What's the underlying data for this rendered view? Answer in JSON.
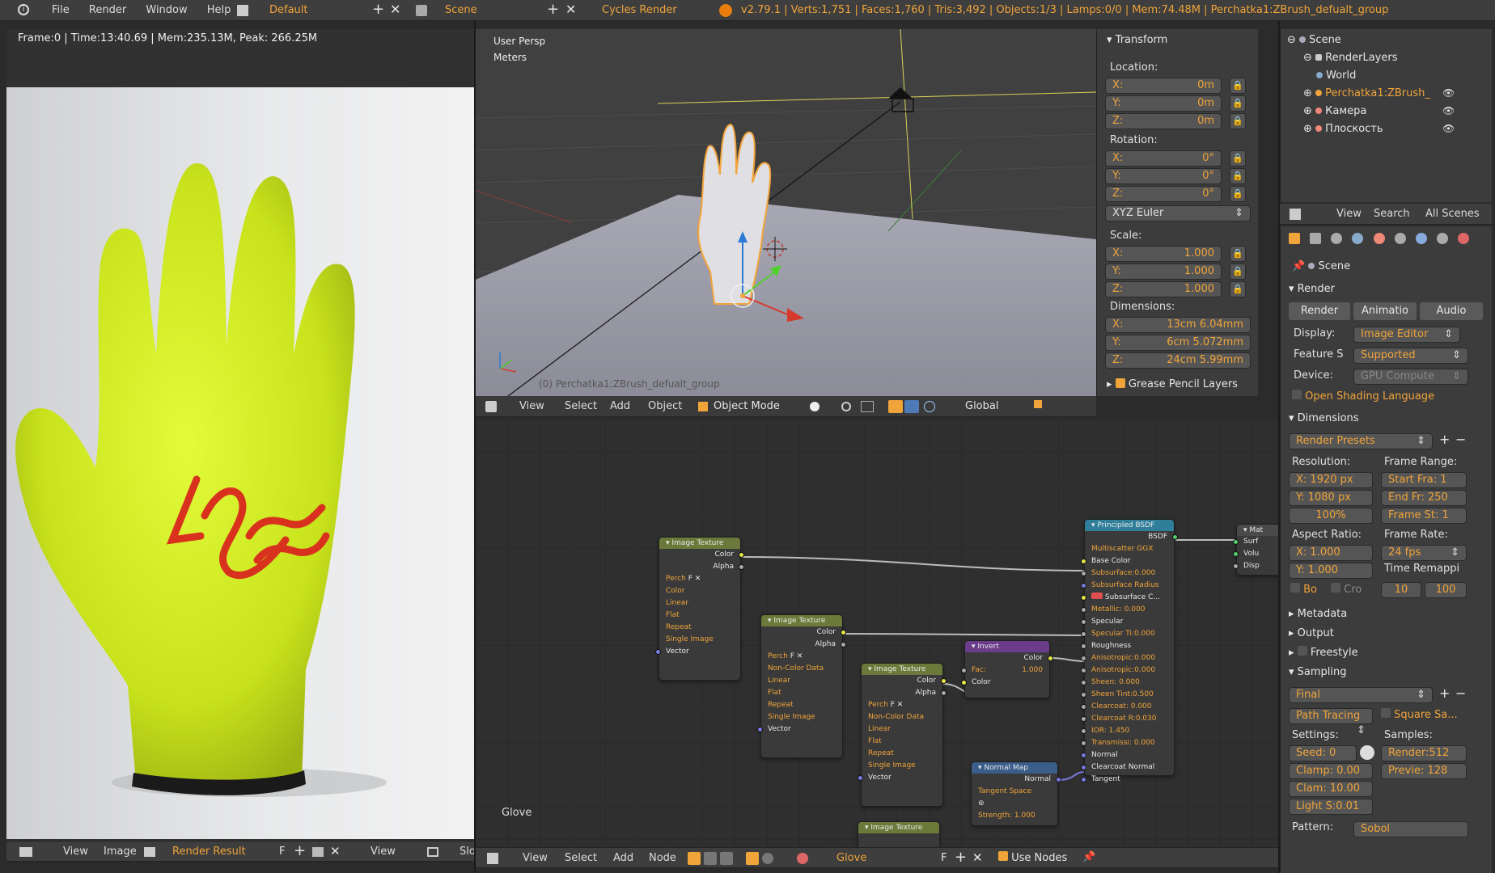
{
  "topbar": {
    "menus": [
      "File",
      "Render",
      "Window",
      "Help"
    ],
    "layout": "Default",
    "scene": "Scene",
    "engine": "Cycles Render",
    "stats": "v2.79.1 | Verts:1,751 | Faces:1,760 | Tris:3,492 | Objects:1/3 | Lamps:0/0 | Mem:74.48M | Perchatka1:ZBrush_defualt_group"
  },
  "image_editor": {
    "header": "Frame:0 | Time:13:40.69 | Mem:235.13M, Peak: 266.25M",
    "footer": {
      "view": "View",
      "image": "Image",
      "name": "Render Result",
      "f": "F",
      "view2": "View",
      "slot": "Slot"
    }
  },
  "viewport": {
    "persp": "User Persp",
    "units": "Meters",
    "object_label": "(0) Perchatka1:ZBrush_defualt_group",
    "header": {
      "view": "View",
      "select": "Select",
      "add": "Add",
      "object": "Object",
      "mode": "Object Mode",
      "orientation": "Global"
    }
  },
  "transform": {
    "title": "Transform",
    "location_label": "Location:",
    "location": [
      {
        "axis": "X:",
        "value": "0m"
      },
      {
        "axis": "Y:",
        "value": "0m"
      },
      {
        "axis": "Z:",
        "value": "0m"
      }
    ],
    "rotation_label": "Rotation:",
    "rotation": [
      {
        "axis": "X:",
        "value": "0°"
      },
      {
        "axis": "Y:",
        "value": "0°"
      },
      {
        "axis": "Z:",
        "value": "0°"
      }
    ],
    "rotation_mode": "XYZ Euler",
    "scale_label": "Scale:",
    "scale": [
      {
        "axis": "X:",
        "value": "1.000"
      },
      {
        "axis": "Y:",
        "value": "1.000"
      },
      {
        "axis": "Z:",
        "value": "1.000"
      }
    ],
    "dimensions_label": "Dimensions:",
    "dimensions": [
      {
        "axis": "X:",
        "value": "13cm 6.04mm"
      },
      {
        "axis": "Y:",
        "value": "6cm 5.072mm"
      },
      {
        "axis": "Z:",
        "value": "24cm 5.99mm"
      }
    ],
    "grease": "Grease Pencil Layers"
  },
  "outliner": {
    "items": [
      {
        "label": "Scene"
      },
      {
        "label": "RenderLayers"
      },
      {
        "label": "World"
      },
      {
        "label": "Perchatka1:ZBrush_"
      },
      {
        "label": "Камера"
      },
      {
        "label": "Плоскость"
      }
    ],
    "header": {
      "view": "View",
      "search": "Search",
      "scenes": "All Scenes"
    }
  },
  "properties": {
    "context": "Scene",
    "render_panel": "Render",
    "render_btn": "Render",
    "anim_btn": "Animatio",
    "audio_btn": "Audio",
    "display_label": "Display:",
    "display_value": "Image Editor",
    "feature_label": "Feature S",
    "feature_value": "Supported",
    "device_label": "Device:",
    "device_value": "GPU Compute",
    "osl": "Open Shading Language",
    "dimensions_panel": "Dimensions",
    "presets": "Render Presets",
    "resolution_label": "Resolution:",
    "res_x": "X:  1920 px",
    "res_y": "Y:  1080 px",
    "res_pct": "100%",
    "frame_range_label": "Frame Range:",
    "start": "Start Fra:  1",
    "end": "End Fr:  250",
    "step": "Frame St:  1",
    "aspect_label": "Aspect Ratio:",
    "asp_x": "X:     1.000",
    "asp_y": "Y:     1.000",
    "fps_label": "Frame Rate:",
    "fps": "24 fps",
    "remap_label": "Time Remappi",
    "remap_old": "10",
    "remap_new": "100",
    "bo": "Bo",
    "cro": "Cro",
    "metadata": "Metadata",
    "output": "Output",
    "freestyle": "Freestyle",
    "sampling": "Sampling",
    "final": "Final",
    "path_tracing": "Path Tracing",
    "square": "Square Sa...",
    "settings_label": "Settings:",
    "samples_label": "Samples:",
    "seed": "Seed:  0",
    "render_samples": "Render:512",
    "clamp1": "Clamp: 0.00",
    "preview": "Previe:  128",
    "clamp2": "Clam: 10.00",
    "light": "Light S:0.01",
    "pattern": "Pattern:",
    "pattern_val": "Sobol"
  },
  "node_editor": {
    "material": "Glove",
    "header": {
      "view": "View",
      "select": "Select",
      "add": "Add",
      "node": "Node",
      "material": "Glove",
      "f": "F",
      "use_nodes": "Use Nodes"
    },
    "img1": {
      "title": "Image Texture",
      "color": "Color",
      "alpha": "Alpha",
      "img": "Perch",
      "f": "F",
      "cs": "Color",
      "interp": "Linear",
      "proj": "Flat",
      "ext": "Repeat",
      "src": "Single Image",
      "vector": "Vector"
    },
    "img2": {
      "title": "Image Texture",
      "color": "Color",
      "alpha": "Alpha",
      "img": "Perch",
      "f": "F",
      "cs": "Non-Color Data",
      "interp": "Linear",
      "proj": "Flat",
      "ext": "Repeat",
      "src": "Single Image",
      "vector": "Vector"
    },
    "img3": {
      "title": "Image Texture",
      "color": "Color",
      "alpha": "Alpha",
      "img": "Perch",
      "f": "F",
      "cs": "Non-Color Data",
      "interp": "Linear",
      "proj": "Flat",
      "ext": "Repeat",
      "src": "Single Image",
      "vector": "Vector"
    },
    "invert": {
      "title": "Invert",
      "color_out": "Color",
      "fac": "Fac:",
      "fac_val": "1.000",
      "color_in": "Color"
    },
    "normalmap": {
      "title": "Normal Map",
      "normal": "Normal",
      "space": "Tangent Space",
      "strength": "Strength: 1.000"
    },
    "img4": {
      "title": "Image Texture"
    },
    "bsdf": {
      "title": "Principled BSDF",
      "out": "BSDF",
      "dist": "Multiscatter GGX",
      "rows": [
        "Base Color",
        "Subsurface:0.000",
        "Subsurface Radius",
        "Subsurface C...",
        "Metallic:   0.000",
        "Specular",
        "Specular Ti:0.000",
        "Roughness",
        "Anisotropic:0.000",
        "Anisotropic:0.000",
        "Sheen:    0.000",
        "Sheen Tint:0.500",
        "Clearcoat:  0.000",
        "Clearcoat R:0.030",
        "IOR:      1.450",
        "Transmissi: 0.000",
        "Normal",
        "Clearcoat Normal",
        "Tangent"
      ]
    },
    "output": {
      "title": "Mat",
      "surf": "Surf",
      "vol": "Volu",
      "disp": "Disp"
    }
  },
  "colors": {
    "accent": "#f0a43a",
    "glove": "#d2ee1f",
    "logo": "#d8321f",
    "bsdf_header": "#2f7f9b",
    "tex_header": "#6b7a3a",
    "invert_header": "#6a3c8a",
    "normal_header": "#3a5d8a"
  }
}
